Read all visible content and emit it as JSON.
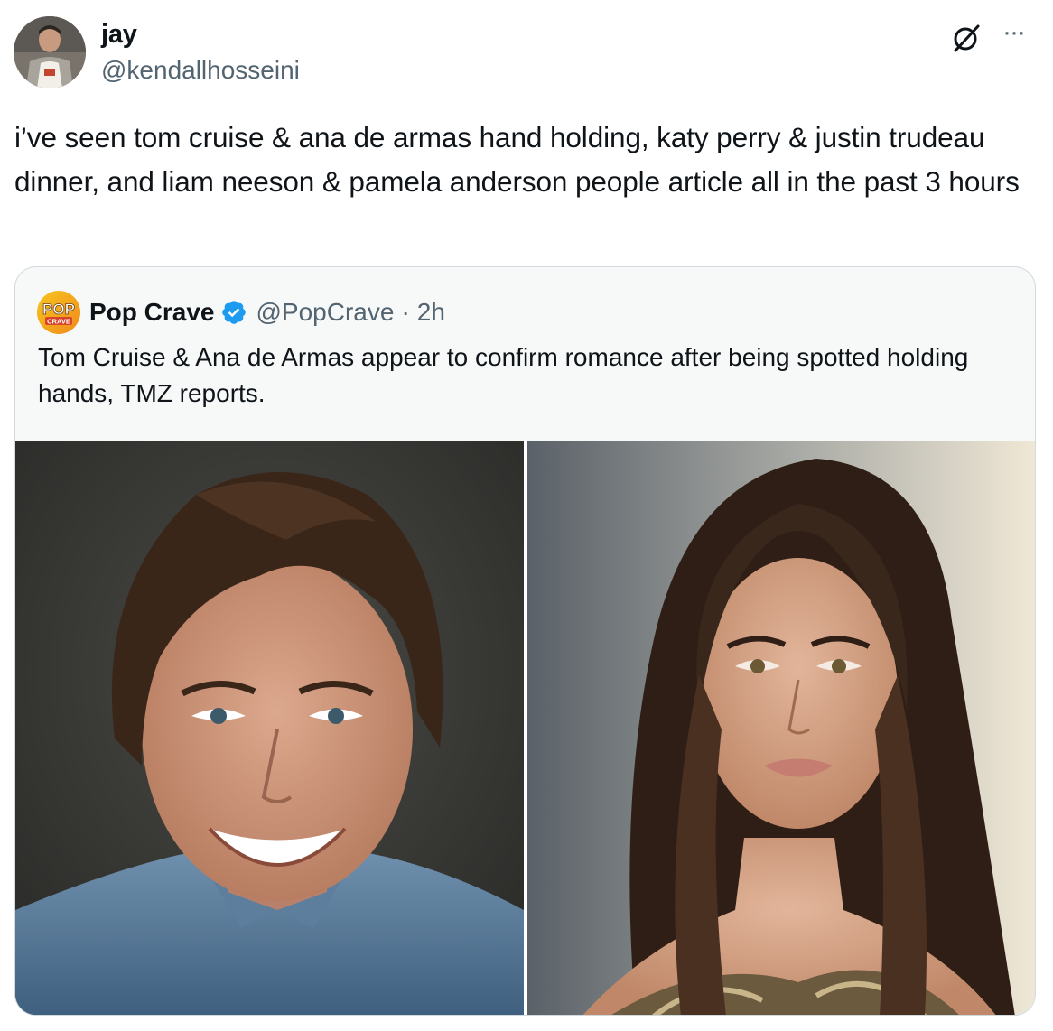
{
  "author": {
    "name": "jay",
    "handle": "@kendallhosseini",
    "avatar_icon": "avatar"
  },
  "tweet": {
    "text": "i’ve seen tom cruise & ana de armas hand holding, katy perry & justin trudeau dinner, and liam neeson & pamela anderson people article all in the past 3 hours"
  },
  "header_icons": {
    "grok": "grok-icon",
    "more": "more-icon",
    "more_glyph": "···"
  },
  "quote": {
    "logo_top": "POP",
    "logo_bottom": "CRAVE",
    "name": "Pop Crave",
    "handle": "@PopCrave",
    "dot": "·",
    "time": "2h",
    "text": "Tom Cruise & Ana de Armas appear to confirm romance after being spotted holding hands, TMZ reports.",
    "photos": [
      {
        "subject": "man-portrait"
      },
      {
        "subject": "woman-portrait"
      }
    ]
  },
  "colors": {
    "text_primary": "#0f1419",
    "text_secondary": "#536471",
    "border": "#cfd9de",
    "verified": "#1d9bf0"
  }
}
